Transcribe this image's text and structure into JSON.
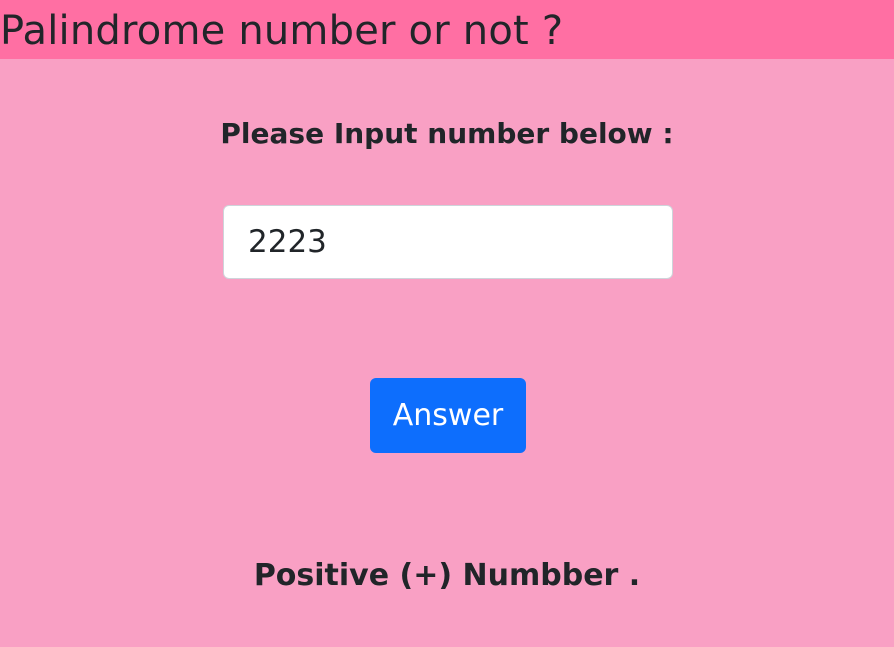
{
  "header": {
    "title": "Palindrome number or not ?"
  },
  "form": {
    "prompt": "Please Input number below :",
    "input_value": "2223",
    "button_label": "Answer"
  },
  "result": {
    "text": "Positive (+) Numbber ."
  },
  "colors": {
    "page_background": "#f9a0c4",
    "header_background": "#ff6fa3",
    "button_background": "#0d6efd"
  }
}
